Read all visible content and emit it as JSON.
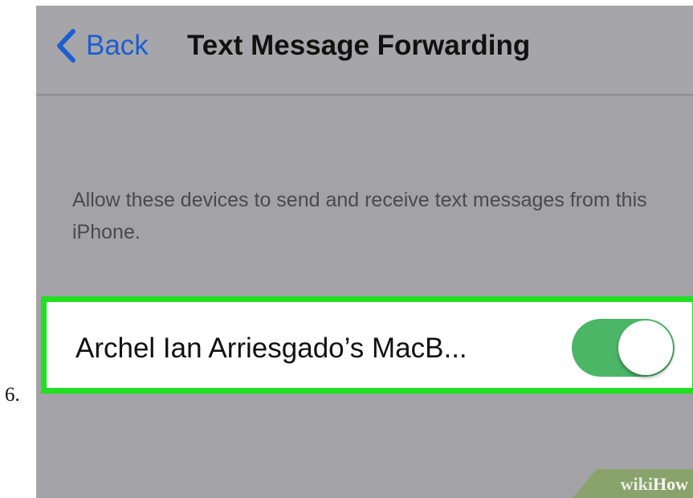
{
  "step": {
    "number": "6."
  },
  "nav": {
    "back_label": "Back",
    "title": "Text Message Forwarding"
  },
  "description": "Allow these devices to send and receive text messages from this iPhone.",
  "device": {
    "name": "Archel Ian Arriesgado’s MacB...",
    "toggle_on": true
  },
  "colors": {
    "accent_blue": "#1b5fd1",
    "toggle_green": "#4cb667",
    "highlight_green": "#1fe11f",
    "screen_gray": "#a3a2a6"
  },
  "icons": {
    "back": "chevron-left-icon"
  },
  "watermark": {
    "part1": "wiki",
    "part2": "How"
  }
}
